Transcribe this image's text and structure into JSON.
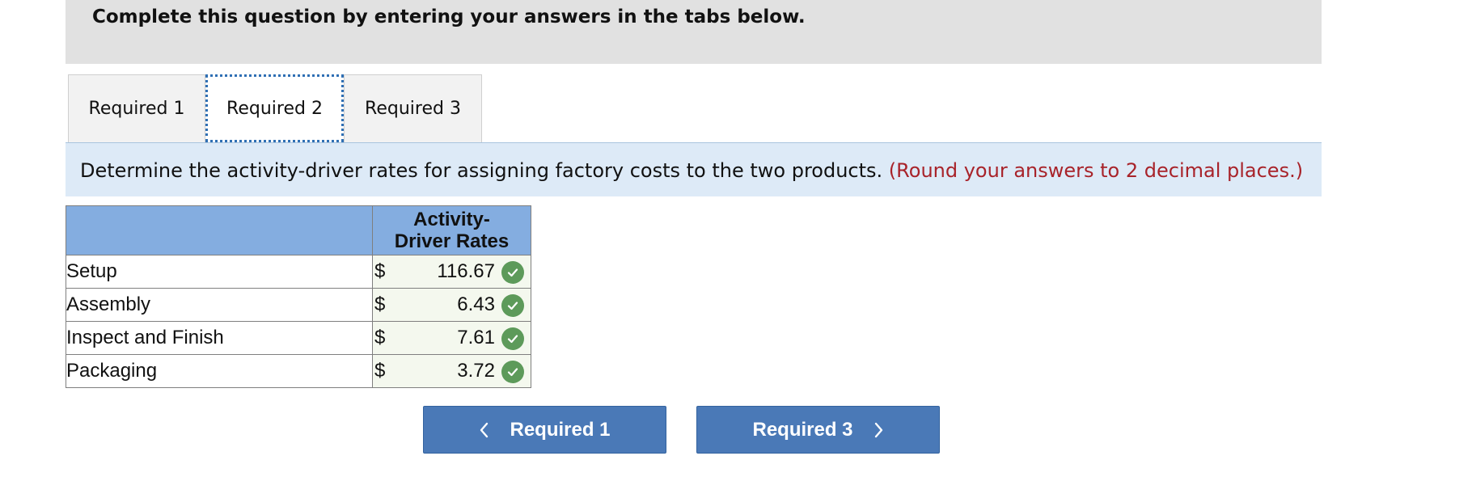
{
  "instruction": "Complete this question by entering your answers in the tabs below.",
  "tabs": [
    {
      "label": "Required 1"
    },
    {
      "label": "Required 2",
      "active": true
    },
    {
      "label": "Required 3"
    }
  ],
  "prompt": {
    "text": "Determine the activity-driver rates for assigning factory costs to the two products.",
    "note": "(Round your answers to 2 decimal places.)"
  },
  "table": {
    "header_line1": "Activity-",
    "header_line2": "Driver Rates",
    "rows": [
      {
        "label": "Setup",
        "currency": "$",
        "value": "116.67",
        "status": "correct"
      },
      {
        "label": "Assembly",
        "currency": "$",
        "value": "6.43",
        "status": "correct"
      },
      {
        "label": "Inspect and Finish",
        "currency": "$",
        "value": "7.61",
        "status": "correct"
      },
      {
        "label": "Packaging",
        "currency": "$",
        "value": "3.72",
        "status": "correct"
      }
    ]
  },
  "nav": {
    "prev_label": "Required 1",
    "next_label": "Required 3"
  },
  "colors": {
    "banner_bg": "#e1e1e1",
    "prompt_bg": "#ddeaf7",
    "note_red": "#a8232a",
    "table_header_bg": "#84ade0",
    "check_green": "#5d9a5a",
    "button_blue": "#4a79b7"
  },
  "icons": {
    "check": "check-circle-icon",
    "prev": "chevron-left-icon",
    "next": "chevron-right-icon"
  }
}
